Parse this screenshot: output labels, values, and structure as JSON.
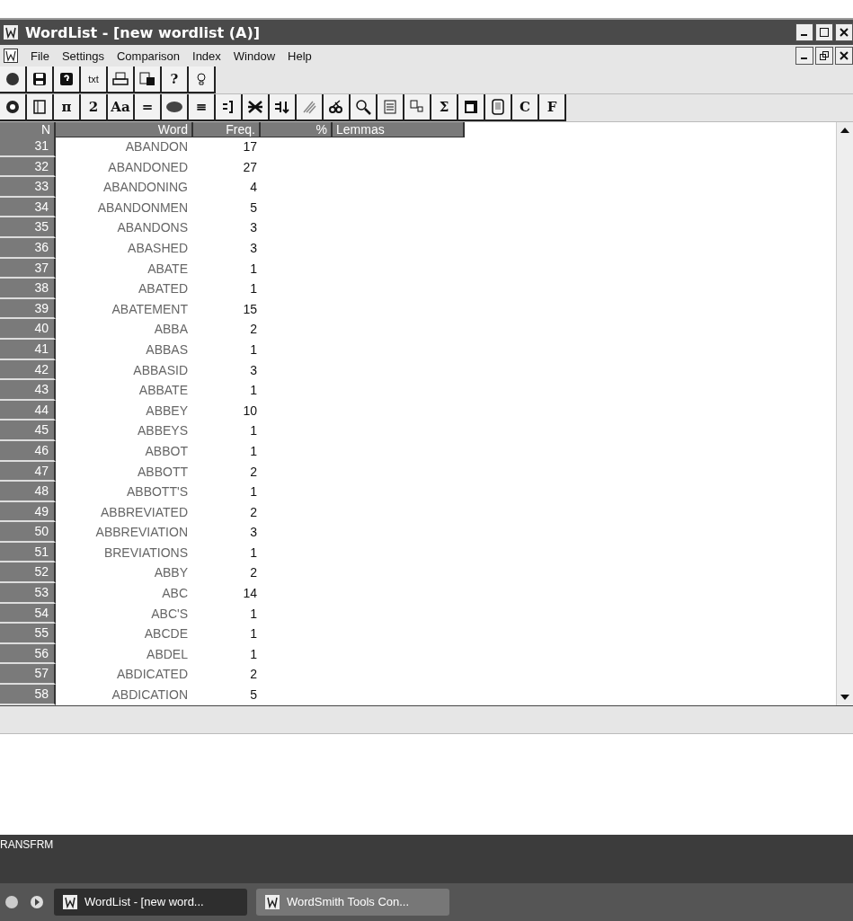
{
  "window": {
    "title": "WordList - [new wordlist (A)]"
  },
  "menu": [
    "File",
    "Settings",
    "Comparison",
    "Index",
    "Window",
    "Help"
  ],
  "toolbar_1": [
    {
      "kind": "icon"
    },
    {
      "kind": "icon"
    },
    {
      "kind": "icon"
    },
    {
      "kind": "text",
      "label": "txt"
    },
    {
      "kind": "icon"
    },
    {
      "kind": "icon"
    },
    {
      "kind": "text",
      "label": "?"
    },
    {
      "kind": "icon"
    }
  ],
  "toolbar_2": [
    {
      "kind": "icon"
    },
    {
      "kind": "icon"
    },
    {
      "kind": "text",
      "label": "π"
    },
    {
      "kind": "text",
      "label": "2"
    },
    {
      "kind": "text",
      "label": "Aa"
    },
    {
      "kind": "text",
      "label": "="
    },
    {
      "kind": "icon"
    },
    {
      "kind": "text",
      "label": "≡"
    },
    {
      "kind": "icon"
    },
    {
      "kind": "icon"
    },
    {
      "kind": "icon"
    },
    {
      "kind": "icon"
    },
    {
      "kind": "icon"
    },
    {
      "kind": "icon"
    },
    {
      "kind": "icon"
    },
    {
      "kind": "icon"
    },
    {
      "kind": "text",
      "label": "Σ"
    },
    {
      "kind": "icon"
    },
    {
      "kind": "icon"
    },
    {
      "kind": "text",
      "label": "C"
    },
    {
      "kind": "text",
      "label": "F"
    }
  ],
  "table": {
    "columns": [
      "N",
      "Word",
      "Freq.",
      "%",
      "Lemmas"
    ],
    "rows": [
      {
        "n": "31",
        "word": "ABANDON",
        "freq": "17"
      },
      {
        "n": "32",
        "word": "ABANDONED",
        "freq": "27"
      },
      {
        "n": "33",
        "word": "ABANDONING",
        "freq": "4"
      },
      {
        "n": "34",
        "word": "ABANDONMEN",
        "freq": "5"
      },
      {
        "n": "35",
        "word": "ABANDONS",
        "freq": "3"
      },
      {
        "n": "36",
        "word": "ABASHED",
        "freq": "3"
      },
      {
        "n": "37",
        "word": "ABATE",
        "freq": "1"
      },
      {
        "n": "38",
        "word": "ABATED",
        "freq": "1"
      },
      {
        "n": "39",
        "word": "ABATEMENT",
        "freq": "15"
      },
      {
        "n": "40",
        "word": "ABBA",
        "freq": "2"
      },
      {
        "n": "41",
        "word": "ABBAS",
        "freq": "1"
      },
      {
        "n": "42",
        "word": "ABBASID",
        "freq": "3"
      },
      {
        "n": "43",
        "word": "ABBATE",
        "freq": "1"
      },
      {
        "n": "44",
        "word": "ABBEY",
        "freq": "10"
      },
      {
        "n": "45",
        "word": "ABBEYS",
        "freq": "1"
      },
      {
        "n": "46",
        "word": "ABBOT",
        "freq": "1"
      },
      {
        "n": "47",
        "word": "ABBOTT",
        "freq": "2"
      },
      {
        "n": "48",
        "word": "ABBOTT'S",
        "freq": "1"
      },
      {
        "n": "49",
        "word": "ABBREVIATED",
        "freq": "2"
      },
      {
        "n": "50",
        "word": "ABBREVIATION",
        "freq": "3"
      },
      {
        "n": "51",
        "word": "BREVIATIONS",
        "freq": "1"
      },
      {
        "n": "52",
        "word": "ABBY",
        "freq": "2"
      },
      {
        "n": "53",
        "word": "ABC",
        "freq": "14"
      },
      {
        "n": "54",
        "word": "ABC'S",
        "freq": "1"
      },
      {
        "n": "55",
        "word": "ABCDE",
        "freq": "1"
      },
      {
        "n": "56",
        "word": "ABDEL",
        "freq": "1"
      },
      {
        "n": "57",
        "word": "ABDICATED",
        "freq": "2"
      },
      {
        "n": "58",
        "word": "ABDICATION",
        "freq": "5"
      }
    ]
  },
  "desktop": {
    "icon_label": "RANSFRM"
  },
  "taskbar": {
    "tasks": [
      {
        "label": "WordList - [new word...",
        "selected": true
      },
      {
        "label": "WordSmith Tools Con...",
        "selected": false
      }
    ]
  }
}
